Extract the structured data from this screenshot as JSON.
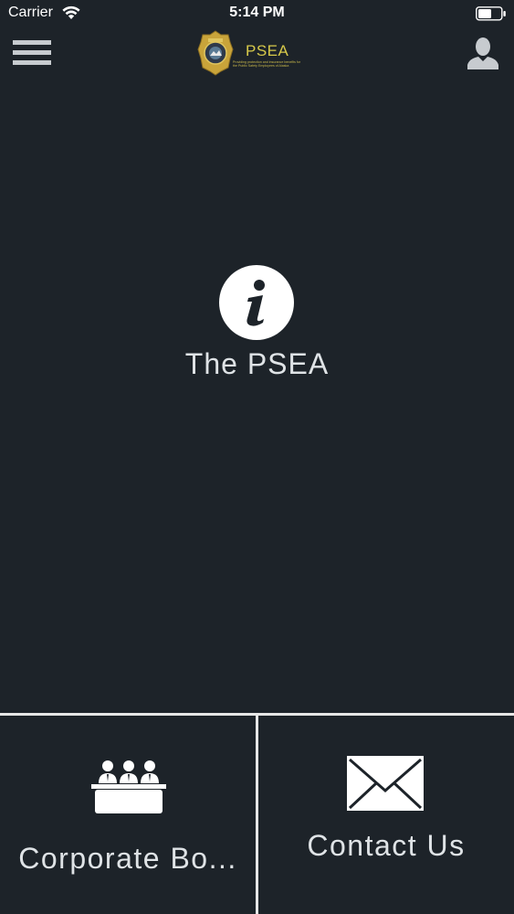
{
  "status_bar": {
    "carrier": "Carrier",
    "time": "5:14 PM"
  },
  "header": {
    "logo_title": "PSEA",
    "logo_tagline": "Providing protection and insurance benefits for the Public Safety Employees of Alaska",
    "accent_color": "#d7c94a"
  },
  "main": {
    "info_label": "The PSEA"
  },
  "tiles": {
    "board_label": "Corporate Bo...",
    "contact_label": "Contact Us"
  },
  "colors": {
    "background": "#1d2329",
    "divider": "#e6e6e6",
    "icon": "#ffffff"
  },
  "icons": [
    "wifi-icon",
    "battery-icon",
    "menu-icon",
    "profile-icon",
    "info-icon",
    "board-meeting-icon",
    "envelope-icon"
  ]
}
